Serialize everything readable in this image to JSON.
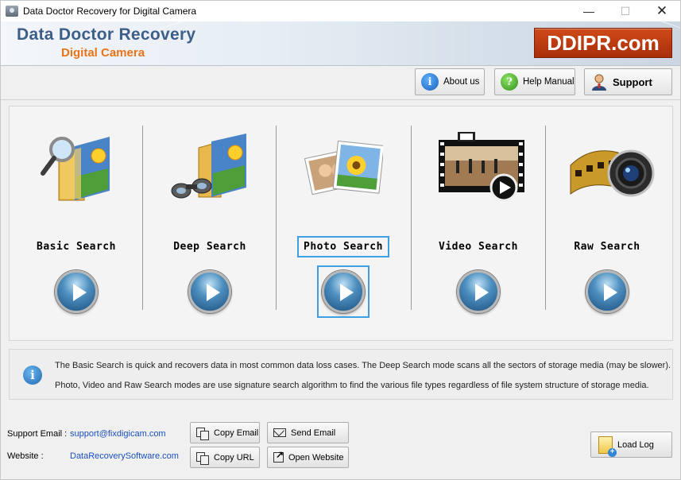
{
  "window": {
    "title": "Data Doctor Recovery for Digital Camera"
  },
  "banner": {
    "brand_line1": "Data Doctor Recovery",
    "brand_line2": "Digital Camera",
    "site_badge": "DDIPR.com"
  },
  "toolbar": {
    "about": "About us",
    "help": "Help Manual",
    "support": "Support"
  },
  "search_modes": [
    {
      "label": "Basic Search",
      "icon": "basic-search-icon"
    },
    {
      "label": "Deep Search",
      "icon": "deep-search-icon"
    },
    {
      "label": "Photo Search",
      "icon": "photo-search-icon",
      "selected": true
    },
    {
      "label": "Video Search",
      "icon": "video-search-icon"
    },
    {
      "label": "Raw Search",
      "icon": "raw-search-icon"
    }
  ],
  "info": {
    "line1": "The Basic Search is quick and recovers data in most common data loss cases. The Deep Search mode scans all the sectors of storage media (may be slower).",
    "line2": "Photo, Video and Raw Search modes are use signature search algorithm to find the various file types regardless of file system structure of storage media."
  },
  "footer": {
    "support_email_label": "Support Email :",
    "support_email": "support@fixdigicam.com",
    "website_label": "Website :",
    "website": "DataRecoverySoftware.com",
    "copy_email": "Copy Email",
    "send_email": "Send Email",
    "copy_url": "Copy URL",
    "open_website": "Open Website",
    "load_log": "Load Log"
  },
  "colors": {
    "brand_blue": "#3d5f87",
    "brand_orange": "#e8741a",
    "badge_red": "#c03e12",
    "selection_blue": "#3f9fe6",
    "link_blue": "#1a4fbf"
  }
}
